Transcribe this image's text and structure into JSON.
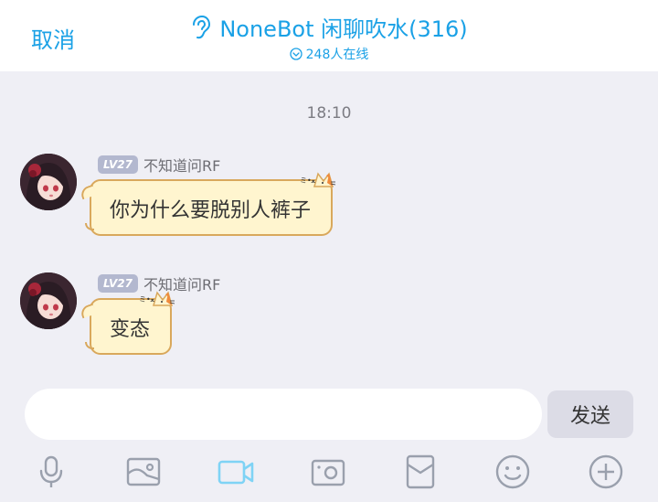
{
  "header": {
    "cancel_label": "取消",
    "title": "NoneBot 闲聊吹水(316)",
    "online_text": "248人在线"
  },
  "chat": {
    "time": "18:10",
    "messages": [
      {
        "level": "LV27",
        "sender": "不知道问RF",
        "text": "你为什么要脱别人裤子"
      },
      {
        "level": "LV27",
        "sender": "不知道问RF",
        "text": "变态"
      }
    ]
  },
  "composer": {
    "input_value": "",
    "send_label": "发送"
  },
  "toolbar": {
    "icons": [
      "microphone-icon",
      "image-icon",
      "video-icon",
      "camera-icon",
      "red-packet-icon",
      "emoji-icon",
      "plus-icon"
    ]
  },
  "colors": {
    "accent": "#1aa1e6",
    "bubble_fill": "#fff5cf",
    "bubble_border": "#d9a85c",
    "background": "#efeff5",
    "toolbar_icon": "#9aa0ad",
    "toolbar_icon_active": "#7fd3f5"
  }
}
